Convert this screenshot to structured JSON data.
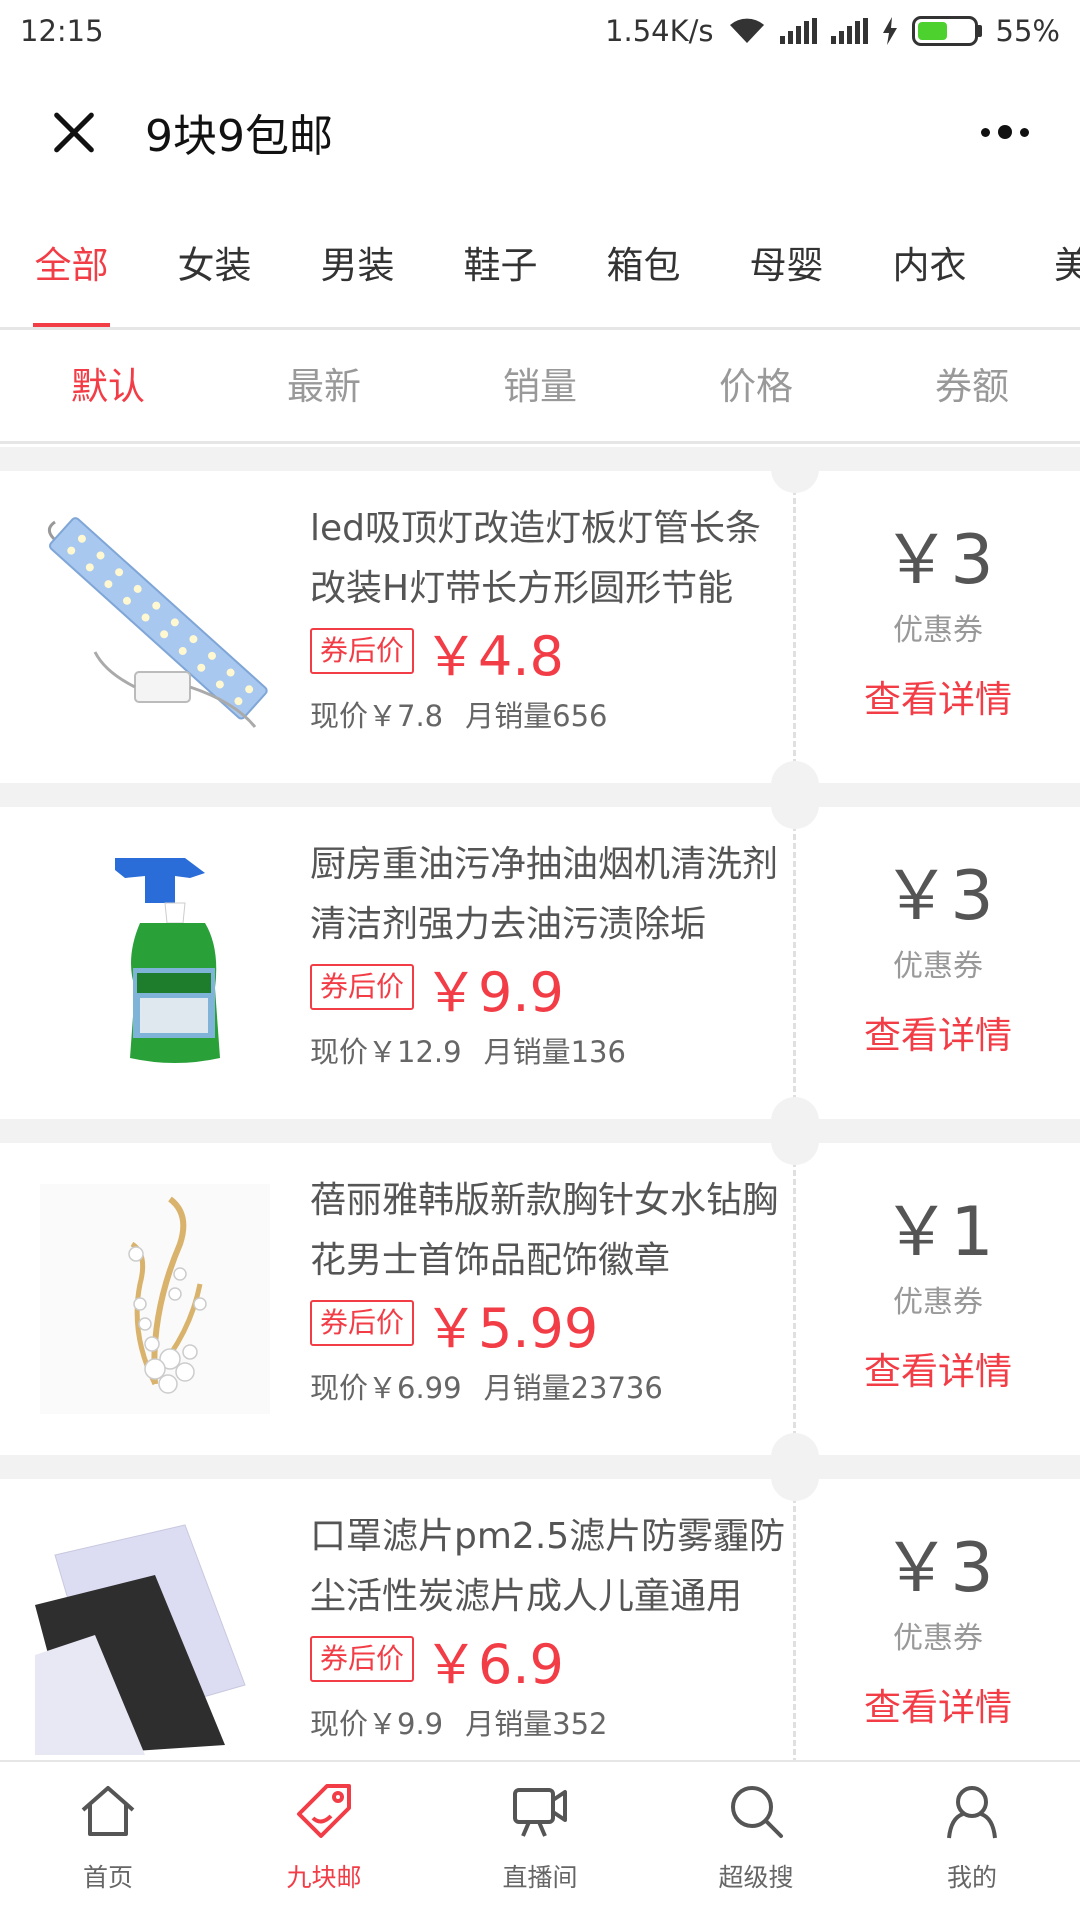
{
  "status_bar": {
    "time": "12:15",
    "speed": "1.54K/s",
    "battery_pct": "55%",
    "battery_level": 0.55
  },
  "header": {
    "title": "9块9包邮"
  },
  "categories": [
    "全部",
    "女装",
    "男装",
    "鞋子",
    "箱包",
    "母婴",
    "内衣",
    "美"
  ],
  "active_category": 0,
  "sort": [
    "默认",
    "最新",
    "销量",
    "价格",
    "券额"
  ],
  "active_sort": 0,
  "products": [
    {
      "name": "led吸顶灯改造灯板灯管长条改装H灯带长方形圆形节能",
      "tag": "券后价",
      "price": "￥4.8",
      "current_price": "现价￥7.8",
      "monthly_sales": "月销量656",
      "coupon_amount": "￥3",
      "coupon_label": "优惠券",
      "detail_label": "查看详情",
      "image": "led-strip"
    },
    {
      "name": "厨房重油污净抽油烟机清洗剂清洁剂强力去油污渍除垢",
      "tag": "券后价",
      "price": "￥9.9",
      "current_price": "现价￥12.9",
      "monthly_sales": "月销量136",
      "coupon_amount": "￥3",
      "coupon_label": "优惠券",
      "detail_label": "查看详情",
      "image": "spray-bottle"
    },
    {
      "name": "蓓丽雅韩版新款胸针女水钻胸花男士首饰品配饰徽章",
      "tag": "券后价",
      "price": "￥5.99",
      "current_price": "现价￥6.99",
      "monthly_sales": "月销量23736",
      "coupon_amount": "￥1",
      "coupon_label": "优惠券",
      "detail_label": "查看详情",
      "image": "brooch"
    },
    {
      "name": "口罩滤片pm2.5滤片防雾霾防尘活性炭滤片成人儿童通用",
      "tag": "券后价",
      "price": "￥6.9",
      "current_price": "现价￥9.9",
      "monthly_sales": "月销量352",
      "coupon_amount": "￥3",
      "coupon_label": "优惠券",
      "detail_label": "查看详情",
      "image": "filter-sheets"
    }
  ],
  "tabbar": [
    {
      "label": "首页",
      "icon": "home-icon"
    },
    {
      "label": "九块邮",
      "icon": "tag-icon"
    },
    {
      "label": "直播间",
      "icon": "live-icon"
    },
    {
      "label": "超级搜",
      "icon": "search-icon"
    },
    {
      "label": "我的",
      "icon": "user-icon"
    }
  ],
  "active_tab": 1,
  "colors": {
    "accent": "#f23d47",
    "background": "#f2f2f2"
  }
}
